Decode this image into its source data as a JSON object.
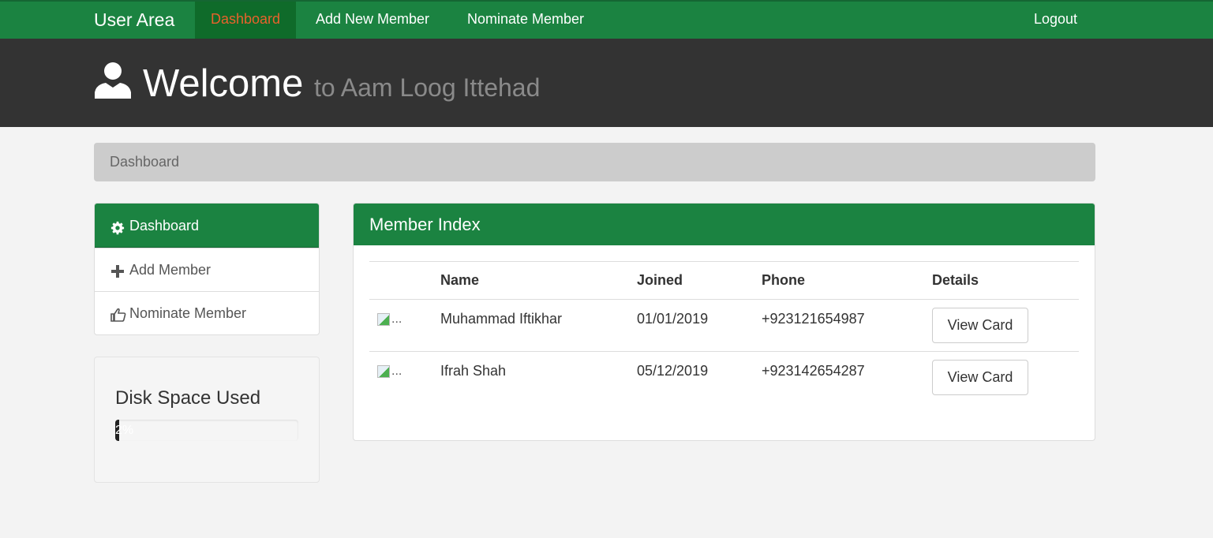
{
  "navbar": {
    "brand": "User Area",
    "items": [
      {
        "label": "Dashboard",
        "active": true
      },
      {
        "label": "Add New Member",
        "active": false
      },
      {
        "label": "Nominate Member",
        "active": false
      }
    ],
    "logout": "Logout"
  },
  "header": {
    "title": "Welcome",
    "subtitle": "to Aam Loog Ittehad",
    "icon": "user-icon"
  },
  "breadcrumb": "Dashboard",
  "sidebar": {
    "items": [
      {
        "label": "Dashboard",
        "icon": "gear-icon",
        "active": true
      },
      {
        "label": "Add Member",
        "icon": "plus-icon",
        "active": false
      },
      {
        "label": "Nominate Member",
        "icon": "thumbs-up-icon",
        "active": false
      }
    ]
  },
  "disk": {
    "title": "Disk Space Used",
    "percent_label": "2%",
    "percent": 2
  },
  "panel": {
    "title": "Member Index",
    "columns": [
      "",
      "Name",
      "Joined",
      "Phone",
      "Details"
    ],
    "rows": [
      {
        "thumb_alt": "...",
        "name": "Muhammad Iftikhar",
        "joined": "01/01/2019",
        "phone": "+923121654987",
        "action": "View Card"
      },
      {
        "thumb_alt": "...",
        "name": "Ifrah Shah",
        "joined": "05/12/2019",
        "phone": "+923142654287",
        "action": "View Card"
      }
    ]
  },
  "colors": {
    "brand_green": "#1b8341",
    "active_nav_text": "#e8622c",
    "header_bg": "#333333"
  }
}
